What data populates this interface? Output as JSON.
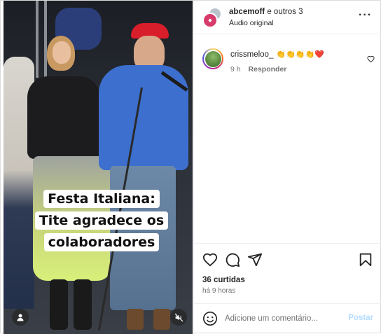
{
  "media": {
    "caption": "Festa Italiana: Tite agradece os colaboradores",
    "user_icon": "user-icon",
    "mute_icon": "muted-speaker-icon"
  },
  "header": {
    "account": "abcemoff",
    "others": "e outros 3",
    "audio": "Áudio original",
    "more_icon": "more-horizontal-icon"
  },
  "comment": {
    "username": "crissmeloo_",
    "emojis": "👏👏👏👏❤️",
    "time": "9 h",
    "reply_label": "Responder"
  },
  "actions": {
    "likes": "36 curtidas",
    "posted": "há 9 horas"
  },
  "add_comment": {
    "placeholder": "Adicione um comentário...",
    "post_label": "Postar"
  },
  "colors": {
    "accent_disabled": "#b3dbff",
    "border": "#dbdbdb",
    "muted_text": "#737373"
  }
}
